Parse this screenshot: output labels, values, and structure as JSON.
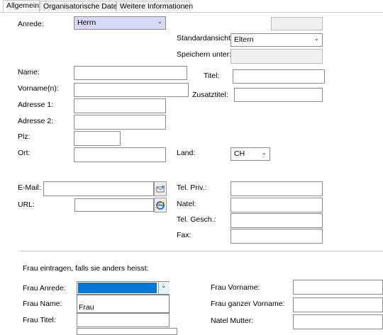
{
  "tabs": [
    "Allgemein",
    "Organisatorische Daten",
    "Weitere Informationen"
  ],
  "labels": {
    "anrede": "Anrede:",
    "standardansicht": "Standardansicht:",
    "speichern_unter": "Speichern unter:",
    "name": "Name:",
    "titel": "Titel:",
    "vorname": "Vorname(n):",
    "zusatztitel": "Zusatztitel:",
    "adresse1": "Adresse 1:",
    "adresse2": "Adresse 2:",
    "plz": "Plz:",
    "ort": "Ort:",
    "land": "Land:",
    "email": "E-Mail:",
    "url": "URL:",
    "tel_priv": "Tel. Priv.:",
    "natel": "Natel:",
    "tel_gesch": "Tel. Gesch.:",
    "fax": "Fax:",
    "frau_section": "Frau eintragen, falls sie anders heisst:",
    "frau_anrede": "Frau Anrede:",
    "frau_name": "Frau Name:",
    "frau_titel": "Frau Titel:",
    "frau_vorname": "Frau Vorname:",
    "frau_ganzer_vorname": "Frau ganzer Vorname:",
    "natel_mutter": "Natel Mutter:"
  },
  "values": {
    "anrede": "Herrn",
    "standardansicht": "Eltern",
    "land": "CH",
    "frau_anrede": ""
  },
  "dropdown_options": [
    "Frau"
  ],
  "icons": {
    "email_button": "mail-icon",
    "url_button": "browser-icon"
  },
  "colors": {
    "anrede_highlight": "#d8d8f8",
    "selection_blue": "#0078d7"
  }
}
